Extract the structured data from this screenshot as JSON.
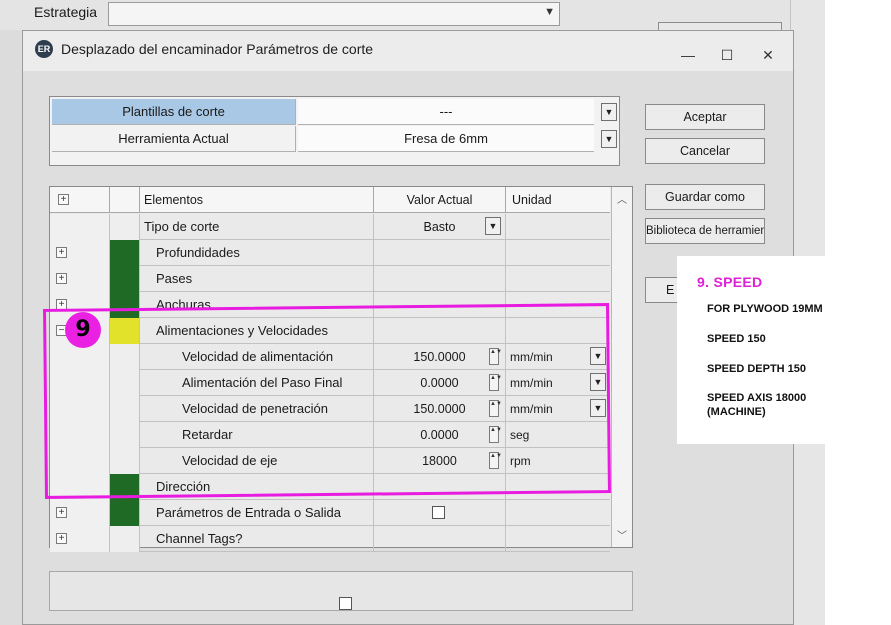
{
  "background_window": {
    "label": "Estrategia",
    "accept_label": "Aceptar"
  },
  "dialog": {
    "title": "Desplazado del encaminador Parámetros de corte",
    "icon_text": "ER",
    "controls": {
      "minimize": "—",
      "maximize": "☐",
      "close": "✕"
    }
  },
  "templates": {
    "rows": [
      {
        "label": "Plantillas de corte",
        "value": "---"
      },
      {
        "label": "Herramienta Actual",
        "value": "Fresa de 6mm"
      }
    ]
  },
  "buttons": {
    "accept": "Aceptar",
    "cancel": "Cancelar",
    "save_as": "Guardar como",
    "tool_library": "Biblioteca de herramienta",
    "partial": "E"
  },
  "grid": {
    "headers": {
      "elements": "Elementos",
      "current_value": "Valor Actual",
      "unit": "Unidad"
    },
    "rows": [
      {
        "name": "Tipo de corte",
        "value": "Basto",
        "unit": "",
        "expander": "",
        "color": "none",
        "indent": 0,
        "control": "dropdown"
      },
      {
        "name": "Profundidades",
        "value": "",
        "unit": "",
        "expander": "+",
        "color": "green",
        "indent": 1,
        "control": ""
      },
      {
        "name": "Pases",
        "value": "",
        "unit": "",
        "expander": "+",
        "color": "green",
        "indent": 1,
        "control": ""
      },
      {
        "name": "Anchuras",
        "value": "",
        "unit": "",
        "expander": "+",
        "color": "green",
        "indent": 1,
        "control": ""
      },
      {
        "name": "Alimentaciones y Velocidades",
        "value": "",
        "unit": "",
        "expander": "−",
        "color": "yellow",
        "indent": 1,
        "control": ""
      },
      {
        "name": "Velocidad de alimentación",
        "value": "150.0000",
        "unit": "mm/min",
        "expander": "",
        "color": "none",
        "indent": 2,
        "control": "spin-dropdown"
      },
      {
        "name": "Alimentación del Paso Final",
        "value": "0.0000",
        "unit": "mm/min",
        "expander": "",
        "color": "none",
        "indent": 2,
        "control": "spin-dropdown"
      },
      {
        "name": "Velocidad de penetración",
        "value": "150.0000",
        "unit": "mm/min",
        "expander": "",
        "color": "none",
        "indent": 2,
        "control": "spin-dropdown"
      },
      {
        "name": "Retardar",
        "value": "0.0000",
        "unit": "seg",
        "expander": "",
        "color": "none",
        "indent": 2,
        "control": "spin"
      },
      {
        "name": "Velocidad de eje",
        "value": "18000",
        "unit": "rpm",
        "expander": "",
        "color": "none",
        "indent": 2,
        "control": "spin"
      },
      {
        "name": "Dirección",
        "value": "",
        "unit": "",
        "expander": "",
        "color": "green",
        "indent": 1,
        "control": ""
      },
      {
        "name": "Parámetros de Entrada o Salida",
        "value": "",
        "unit": "",
        "expander": "+",
        "color": "green",
        "indent": 1,
        "control": "checkbox"
      },
      {
        "name": "Channel Tags?",
        "value": "",
        "unit": "",
        "expander": "+",
        "color": "none",
        "indent": 1,
        "control": ""
      }
    ]
  },
  "annotation": {
    "step_number": "9",
    "highlight_color": "#e81ce0"
  },
  "note": {
    "title": "9. SPEED",
    "lines": [
      "FOR PLYWOOD 19MM",
      "SPEED 150",
      "SPEED DEPTH 150",
      "SPEED AXIS 18000 (MACHINE)"
    ]
  },
  "colors": {
    "selected_row": "#a9c8e6",
    "group_green": "#1f6a25",
    "group_yellow": "#e3e22a",
    "accent_magenta": "#e020d8"
  },
  "icons": {
    "expand": "plus-box-icon",
    "collapse": "minus-box-icon",
    "dropdown": "chevron-down-icon",
    "spinner": "spin-arrows-icon",
    "scroll_up": "chevron-up-icon",
    "scroll_down": "chevron-down-icon"
  }
}
